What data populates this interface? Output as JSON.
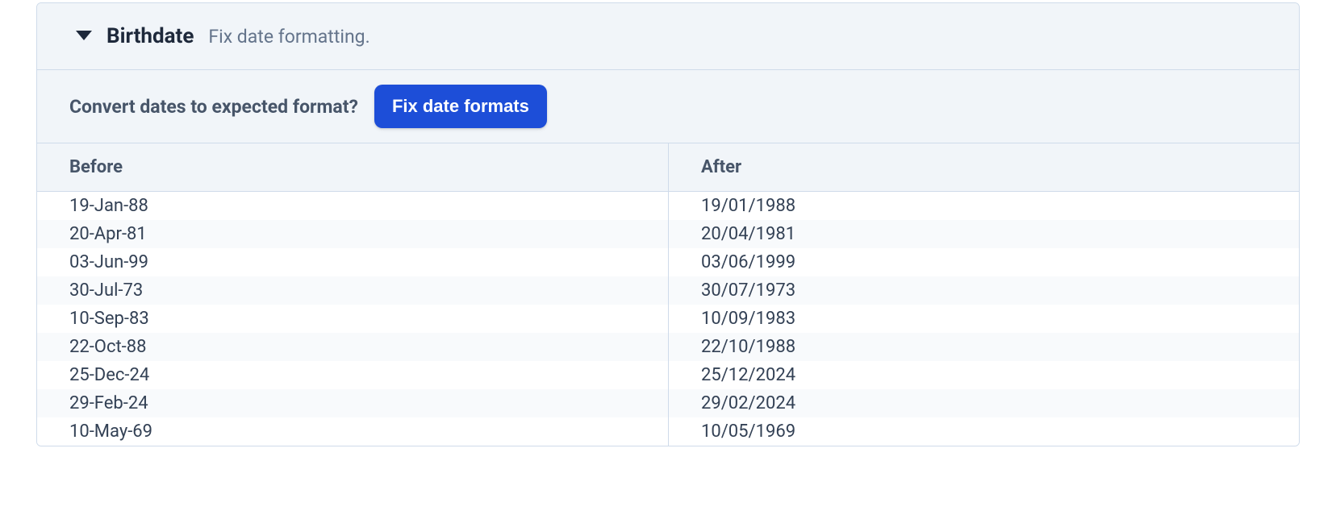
{
  "header": {
    "title": "Birthdate",
    "subtitle": "Fix date formatting."
  },
  "action": {
    "question": "Convert dates to expected format?",
    "button_label": "Fix date formats"
  },
  "table": {
    "columns": {
      "before": "Before",
      "after": "After"
    },
    "rows": [
      {
        "before": "19-Jan-88",
        "after": "19/01/1988"
      },
      {
        "before": "20-Apr-81",
        "after": "20/04/1981"
      },
      {
        "before": "03-Jun-99",
        "after": "03/06/1999"
      },
      {
        "before": "30-Jul-73",
        "after": "30/07/1973"
      },
      {
        "before": "10-Sep-83",
        "after": "10/09/1983"
      },
      {
        "before": "22-Oct-88",
        "after": "22/10/1988"
      },
      {
        "before": "25-Dec-24",
        "after": "25/12/2024"
      },
      {
        "before": "29-Feb-24",
        "after": "29/02/2024"
      },
      {
        "before": "10-May-69",
        "after": "10/05/1969"
      }
    ]
  }
}
